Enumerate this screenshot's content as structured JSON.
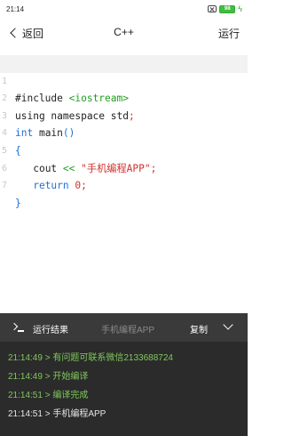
{
  "status_bar": {
    "time": "21:14",
    "battery": "98"
  },
  "nav": {
    "back_label": "返回",
    "title": "C++",
    "run_label": "运行"
  },
  "editor": {
    "line_numbers": [
      "1",
      "2",
      "3",
      "4",
      "5",
      "6",
      "7"
    ],
    "lines": {
      "l1_directive": "#include ",
      "l1_header": "<iostream>",
      "l2_text": "using namespace std",
      "l2_semicolon": ";",
      "l3_kw": "int",
      "l3_name": " main",
      "l3_parens": "()",
      "l4_brace": "{",
      "l5_indent": "   ",
      "l5_cout": "cout ",
      "l5_op": "<<",
      "l5_space": " ",
      "l5_string": "\"手机编程APP\"",
      "l5_semicolon": ";",
      "l6_indent": "   ",
      "l6_return": "return",
      "l6_space": " ",
      "l6_value": "0",
      "l6_semicolon": ";",
      "l7_brace": "}"
    }
  },
  "console": {
    "title": "运行结果",
    "subtitle": "手机编程APP",
    "copy_label": "复制",
    "logs": [
      {
        "text": "21:14:49 > 有问题可联系微信2133688724"
      },
      {
        "text": "21:14:49 > 开始编译"
      },
      {
        "text": "21:14:51 > 编译完成"
      },
      {
        "text": "21:14:51 > 手机编程APP"
      }
    ]
  }
}
